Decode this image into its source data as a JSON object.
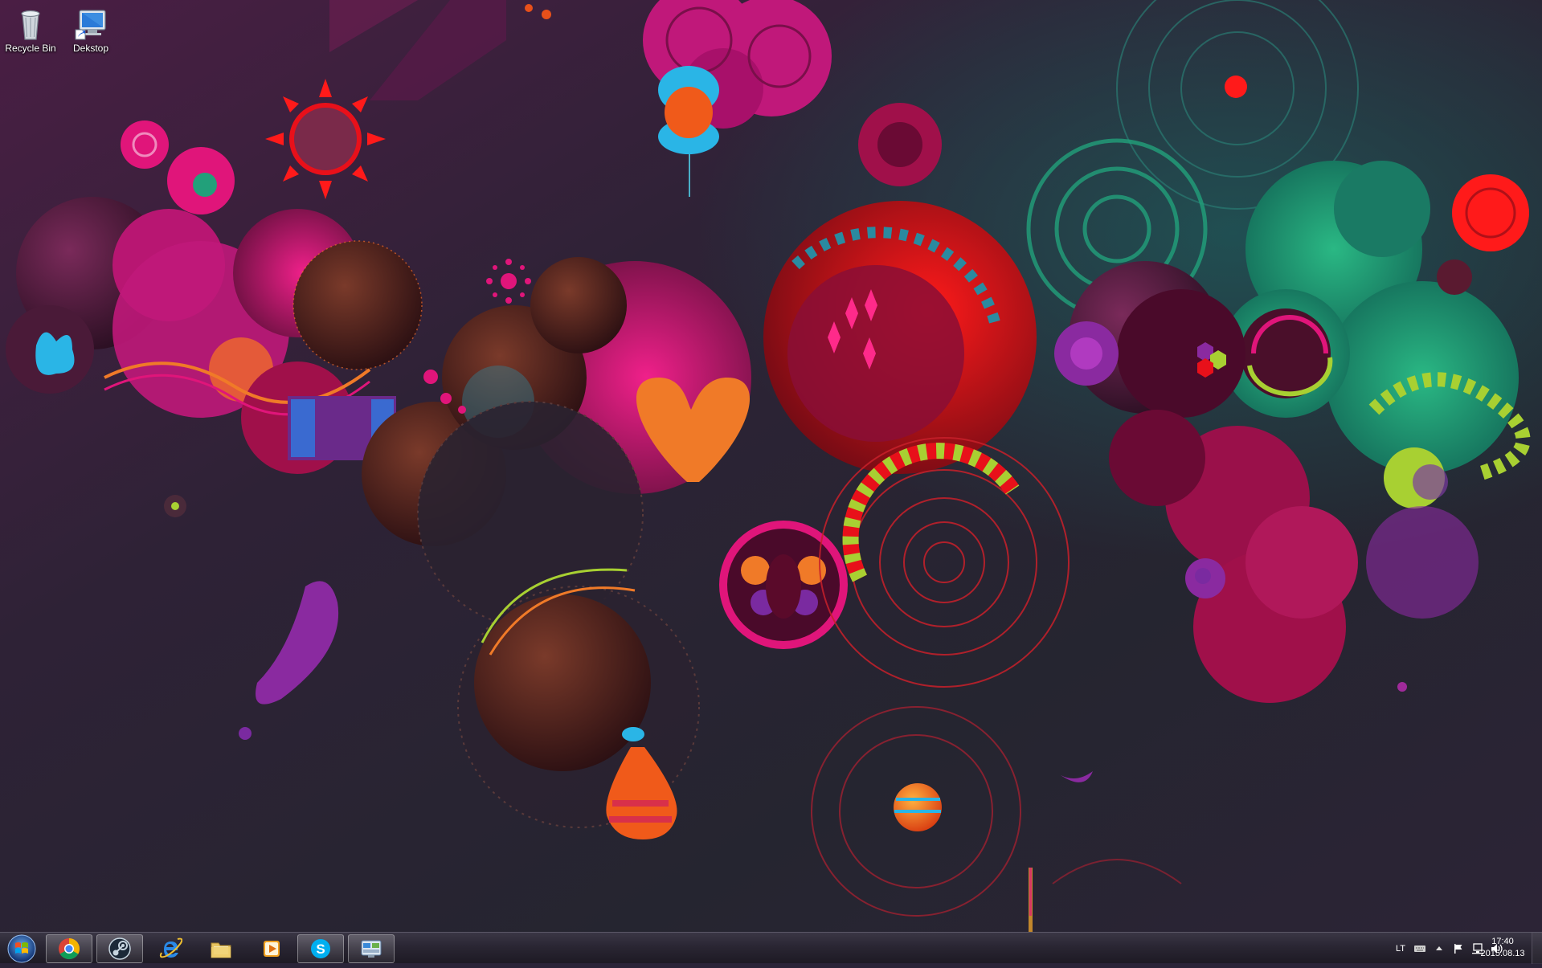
{
  "desktop": {
    "icons": [
      {
        "label": "Recycle Bin",
        "icon": "recycle-bin-icon"
      },
      {
        "label": "Dekstop",
        "icon": "computer-shortcut-icon"
      }
    ]
  },
  "taskbar": {
    "start": {
      "icon": "windows-start-icon"
    },
    "pinned": [
      {
        "name": "Google Chrome",
        "icon": "chrome-icon",
        "active": true
      },
      {
        "name": "Steam",
        "icon": "steam-icon",
        "active": true
      },
      {
        "name": "Internet Explorer",
        "icon": "internet-explorer-icon",
        "active": false
      },
      {
        "name": "Windows Explorer",
        "icon": "folder-icon",
        "active": false
      },
      {
        "name": "Media Player",
        "icon": "media-player-icon",
        "active": false
      },
      {
        "name": "Skype",
        "icon": "skype-icon",
        "active": true
      },
      {
        "name": "Control Panel",
        "icon": "control-panel-icon",
        "active": true
      }
    ],
    "tray": {
      "language": "LT",
      "icons": [
        "keyboard-icon",
        "show-hidden-icons-arrow",
        "action-center-flag-icon",
        "network-icon",
        "volume-icon"
      ]
    },
    "clock": {
      "time": "17:40",
      "date": "2015.08.13"
    }
  },
  "colors": {
    "background": "#2a2438",
    "magenta": "#e0157a",
    "red": "#e8101a",
    "orange": "#f07a28",
    "teal": "#22a07a",
    "cyan": "#2ab5e6",
    "lime": "#a8d032",
    "purple": "#8a2aa0"
  }
}
